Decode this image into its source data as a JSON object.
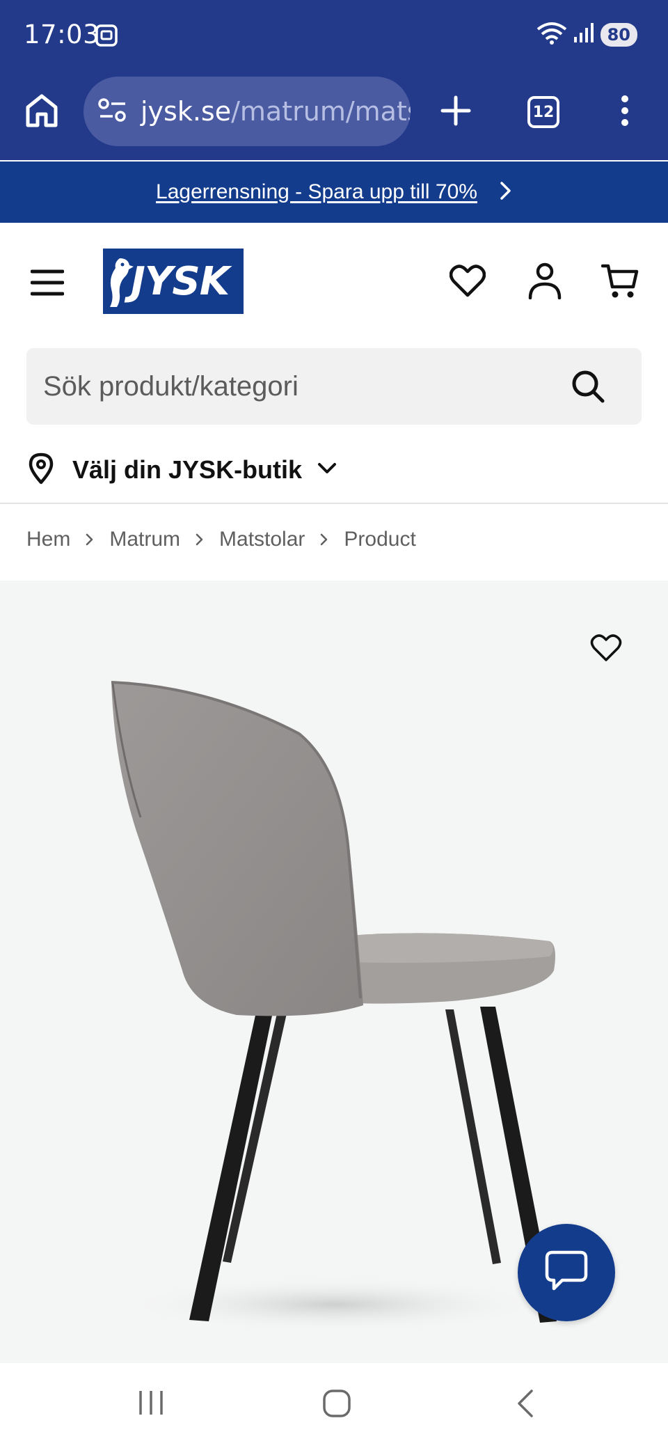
{
  "status_bar": {
    "time": "17:03",
    "battery": "80",
    "icons": [
      "screenshot-icon",
      "wifi-icon",
      "signal-icon",
      "battery-icon"
    ]
  },
  "browser": {
    "url_domain": "jysk.se",
    "url_path": "/matrum/mats",
    "tab_count": "12"
  },
  "promo": {
    "text": "Lagerrensning - Spara upp till 70%"
  },
  "header": {
    "logo_text": "JYSK"
  },
  "search": {
    "placeholder": "Sök produkt/kategori"
  },
  "store": {
    "label": "Välj din JYSK-butik"
  },
  "breadcrumb": {
    "items": [
      "Hem",
      "Matrum",
      "Matstolar",
      "Product"
    ]
  },
  "colors": {
    "chrome": "#233a8b",
    "brand": "#143c8c",
    "product_bg": "#f4f5f5"
  }
}
